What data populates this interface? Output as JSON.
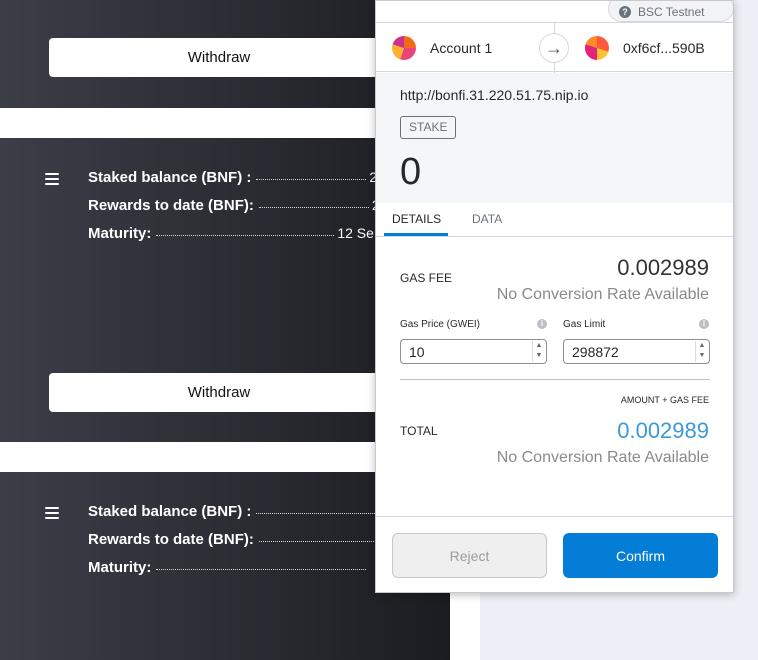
{
  "stake_cards": {
    "withdraw_label": "Withdraw",
    "card2": {
      "staked_label": "Staked balance (BNF) :",
      "staked_value": "2,",
      "rewards_label": "Rewards to date (BNF):",
      "rewards_value": "2,",
      "maturity_label": "Maturity:",
      "maturity_value": "12 Se"
    },
    "card3": {
      "staked_label": "Staked balance (BNF) :",
      "rewards_label": "Rewards to date (BNF):",
      "maturity_label": "Maturity:"
    }
  },
  "metamask": {
    "network": "BSC Testnet",
    "network_icon": "question-icon",
    "from_account": "Account 1",
    "to_address": "0xf6cf...590B",
    "origin": "http://bonfi.31.220.51.75.nip.io",
    "method": "STAKE",
    "amount": "0",
    "tabs": [
      "DETAILS",
      "DATA"
    ],
    "gas_fee_label": "GAS FEE",
    "gas_fee_value": "0.002989",
    "no_conversion": "No Conversion Rate Available",
    "gas_price_label": "Gas Price (GWEI)",
    "gas_price_value": "10",
    "gas_limit_label": "Gas Limit",
    "gas_limit_value": "298872",
    "amount_gas_label": "AMOUNT + GAS FEE",
    "total_label": "TOTAL",
    "total_value": "0.002989",
    "reject_label": "Reject",
    "confirm_label": "Confirm",
    "colors": {
      "accent": "#037dd6",
      "total_value": "#3b99d8",
      "muted": "#8a8a8a"
    }
  }
}
